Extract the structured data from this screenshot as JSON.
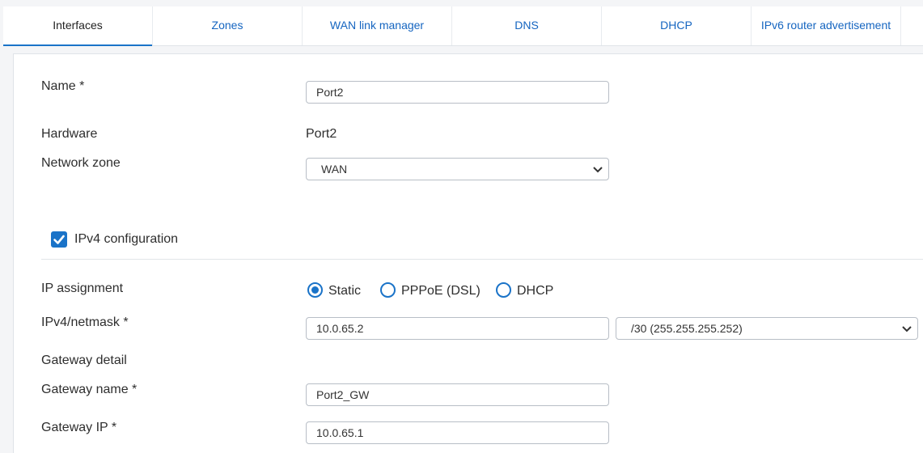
{
  "tabs": [
    {
      "label": "Interfaces",
      "active": true
    },
    {
      "label": "Zones"
    },
    {
      "label": "WAN link manager"
    },
    {
      "label": "DNS"
    },
    {
      "label": "DHCP"
    },
    {
      "label": "IPv6 router advertisement"
    }
  ],
  "form": {
    "name": {
      "label": "Name *",
      "value": "Port2"
    },
    "hardware": {
      "label": "Hardware",
      "value": "Port2"
    },
    "network_zone": {
      "label": "Network zone",
      "value": "WAN"
    },
    "ipv4_config": {
      "label": "IPv4 configuration",
      "checked": true
    },
    "ip_assignment": {
      "label": "IP assignment",
      "options": [
        "Static",
        "PPPoE (DSL)",
        "DHCP"
      ],
      "selected": "Static"
    },
    "ipv4_netmask": {
      "label": "IPv4/netmask *",
      "ip": "10.0.65.2",
      "netmask": "/30 (255.255.255.252)"
    },
    "gateway_detail": {
      "label": "Gateway detail"
    },
    "gateway_name": {
      "label": "Gateway name *",
      "value": "Port2_GW"
    },
    "gateway_ip": {
      "label": "Gateway IP *",
      "value": "10.0.65.1"
    }
  },
  "colors": {
    "accent": "#1a73c8",
    "tab_link": "#1565c0"
  },
  "icons": {
    "dropdown": "chevron-down-icon",
    "checkbox": "checkmark-icon"
  }
}
